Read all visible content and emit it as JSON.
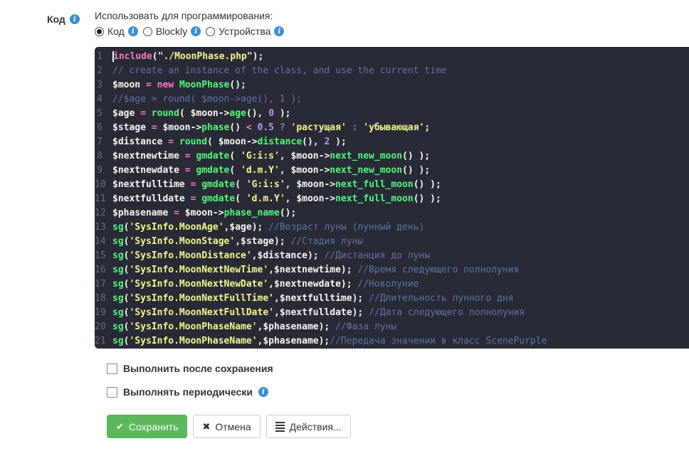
{
  "colors": {
    "info-icon": "#3d8fd1",
    "editor-bg": "#282a36",
    "code-text": "#f8f8f2",
    "tok-kw": "#ff79c6",
    "tok-fn": "#50fa7b",
    "tok-str": "#f1fa8c",
    "tok-num": "#bd93f9",
    "tok-cm": "#6272a4",
    "line-number": "#636d83",
    "save-bg": "#5cb85c",
    "save-border": "#4cae4c",
    "btn-border": "#cccccc"
  },
  "icons": {
    "save": "✔",
    "cancel": "✖"
  },
  "form": {
    "field_label": "Код",
    "usage_label": "Использовать для программирования:",
    "options": [
      {
        "key": "code",
        "label": "Код",
        "selected": true,
        "info": true
      },
      {
        "key": "blockly",
        "label": "Blockly",
        "selected": false,
        "info": true
      },
      {
        "key": "devices",
        "label": "Устройства",
        "selected": false,
        "info": true
      }
    ],
    "checkboxes": [
      {
        "key": "run-after-save",
        "label": "Выполнить после сохранения",
        "checked": false,
        "info": false
      },
      {
        "key": "run-periodically",
        "label": "Выполнять периодически",
        "checked": false,
        "info": true
      }
    ],
    "buttons": {
      "save": "Сохранить",
      "cancel": "Отмена",
      "actions": "Действия..."
    }
  },
  "editor": {
    "language": "php",
    "cursor": {
      "line": 1,
      "col": 0
    },
    "lines": [
      [
        [
          "kw",
          "include"
        ],
        [
          "pl",
          "("
        ],
        [
          "str",
          "\"./MoonPhase.php\""
        ],
        [
          "pl",
          ");"
        ]
      ],
      [
        [
          "cm",
          "// create an instance of the class, and use the current time"
        ]
      ],
      [
        [
          "var",
          "$moon"
        ],
        [
          "pl",
          " "
        ],
        [
          "kw",
          "="
        ],
        [
          "pl",
          " "
        ],
        [
          "kw",
          "new"
        ],
        [
          "pl",
          " "
        ],
        [
          "fn",
          "MoonPhase"
        ],
        [
          "pl",
          "();"
        ]
      ],
      [
        [
          "cm",
          "//$age = round( $moon->age(), 1 );"
        ]
      ],
      [
        [
          "var",
          "$age"
        ],
        [
          "pl",
          " "
        ],
        [
          "kw",
          "="
        ],
        [
          "pl",
          " "
        ],
        [
          "fn",
          "round"
        ],
        [
          "pl",
          "( "
        ],
        [
          "var",
          "$moon"
        ],
        [
          "pl",
          "->"
        ],
        [
          "fn",
          "age"
        ],
        [
          "pl",
          "(), "
        ],
        [
          "num",
          "0"
        ],
        [
          "pl",
          " );"
        ]
      ],
      [
        [
          "var",
          "$stage"
        ],
        [
          "pl",
          " "
        ],
        [
          "kw",
          "="
        ],
        [
          "pl",
          " "
        ],
        [
          "var",
          "$moon"
        ],
        [
          "pl",
          "->"
        ],
        [
          "fn",
          "phase"
        ],
        [
          "pl",
          "() "
        ],
        [
          "kw",
          "<"
        ],
        [
          "pl",
          " "
        ],
        [
          "num",
          "0.5"
        ],
        [
          "dim",
          " ? "
        ],
        [
          "str",
          "'растущая'"
        ],
        [
          "dim",
          " : "
        ],
        [
          "str",
          "'убывающая'"
        ],
        [
          "pl",
          ";"
        ]
      ],
      [
        [
          "var",
          "$distance"
        ],
        [
          "pl",
          " "
        ],
        [
          "kw",
          "="
        ],
        [
          "pl",
          " "
        ],
        [
          "fn",
          "round"
        ],
        [
          "pl",
          "( "
        ],
        [
          "var",
          "$moon"
        ],
        [
          "pl",
          "->"
        ],
        [
          "fn",
          "distance"
        ],
        [
          "pl",
          "(), "
        ],
        [
          "num",
          "2"
        ],
        [
          "pl",
          " );"
        ]
      ],
      [
        [
          "var",
          "$nextnewtime"
        ],
        [
          "pl",
          " "
        ],
        [
          "kw",
          "="
        ],
        [
          "pl",
          " "
        ],
        [
          "fn",
          "gmdate"
        ],
        [
          "pl",
          "( "
        ],
        [
          "str",
          "'G:i:s'"
        ],
        [
          "pl",
          ", "
        ],
        [
          "var",
          "$moon"
        ],
        [
          "pl",
          "->"
        ],
        [
          "fn",
          "next_new_moon"
        ],
        [
          "pl",
          "() );"
        ]
      ],
      [
        [
          "var",
          "$nextnewdate"
        ],
        [
          "pl",
          " "
        ],
        [
          "kw",
          "="
        ],
        [
          "pl",
          " "
        ],
        [
          "fn",
          "gmdate"
        ],
        [
          "pl",
          "( "
        ],
        [
          "str",
          "'d.m.Y'"
        ],
        [
          "pl",
          ", "
        ],
        [
          "var",
          "$moon"
        ],
        [
          "pl",
          "->"
        ],
        [
          "fn",
          "next_new_moon"
        ],
        [
          "pl",
          "() );"
        ]
      ],
      [
        [
          "var",
          "$nextfulltime"
        ],
        [
          "pl",
          " "
        ],
        [
          "kw",
          "="
        ],
        [
          "pl",
          " "
        ],
        [
          "fn",
          "gmdate"
        ],
        [
          "pl",
          "( "
        ],
        [
          "str",
          "'G:i:s'"
        ],
        [
          "pl",
          ", "
        ],
        [
          "var",
          "$moon"
        ],
        [
          "pl",
          "->"
        ],
        [
          "fn",
          "next_full_moon"
        ],
        [
          "pl",
          "() );"
        ]
      ],
      [
        [
          "var",
          "$nextfulldate"
        ],
        [
          "pl",
          " "
        ],
        [
          "kw",
          "="
        ],
        [
          "pl",
          " "
        ],
        [
          "fn",
          "gmdate"
        ],
        [
          "pl",
          "( "
        ],
        [
          "str",
          "'d.m.Y'"
        ],
        [
          "pl",
          ", "
        ],
        [
          "var",
          "$moon"
        ],
        [
          "pl",
          "->"
        ],
        [
          "fn",
          "next_full_moon"
        ],
        [
          "pl",
          "() );"
        ]
      ],
      [
        [
          "var",
          "$phasename"
        ],
        [
          "pl",
          " "
        ],
        [
          "kw",
          "="
        ],
        [
          "pl",
          " "
        ],
        [
          "var",
          "$moon"
        ],
        [
          "pl",
          "->"
        ],
        [
          "fn",
          "phase_name"
        ],
        [
          "pl",
          "();"
        ]
      ],
      [
        [
          "fn",
          "sg"
        ],
        [
          "pl",
          "("
        ],
        [
          "str",
          "'SysInfo.MoonAge'"
        ],
        [
          "pl",
          ","
        ],
        [
          "var",
          "$age"
        ],
        [
          "pl",
          "); "
        ],
        [
          "cm",
          "//Возраст луны (лунный день)"
        ]
      ],
      [
        [
          "fn",
          "sg"
        ],
        [
          "pl",
          "("
        ],
        [
          "str",
          "'SysInfo.MoonStage'"
        ],
        [
          "pl",
          ","
        ],
        [
          "var",
          "$stage"
        ],
        [
          "pl",
          "); "
        ],
        [
          "cm",
          "//Стадия луны"
        ]
      ],
      [
        [
          "fn",
          "sg"
        ],
        [
          "pl",
          "("
        ],
        [
          "str",
          "'SysInfo.MoonDistance'"
        ],
        [
          "pl",
          ","
        ],
        [
          "var",
          "$distance"
        ],
        [
          "pl",
          "); "
        ],
        [
          "cm",
          "//Дистанция до луны"
        ]
      ],
      [
        [
          "fn",
          "sg"
        ],
        [
          "pl",
          "("
        ],
        [
          "str",
          "'SysInfo.MoonNextNewTime'"
        ],
        [
          "pl",
          ","
        ],
        [
          "var",
          "$nextnewtime"
        ],
        [
          "pl",
          "); "
        ],
        [
          "cm",
          "//Время следующего полнолуния"
        ]
      ],
      [
        [
          "fn",
          "sg"
        ],
        [
          "pl",
          "("
        ],
        [
          "str",
          "'SysInfo.MoonNextNewDate'"
        ],
        [
          "pl",
          ","
        ],
        [
          "var",
          "$nextnewdate"
        ],
        [
          "pl",
          "); "
        ],
        [
          "cm",
          "//Новолуние"
        ]
      ],
      [
        [
          "fn",
          "sg"
        ],
        [
          "pl",
          "("
        ],
        [
          "str",
          "'SysInfo.MoonNextFullTime'"
        ],
        [
          "pl",
          ","
        ],
        [
          "var",
          "$nextfulltime"
        ],
        [
          "pl",
          "); "
        ],
        [
          "cm",
          "//Длительность лунного дня"
        ]
      ],
      [
        [
          "fn",
          "sg"
        ],
        [
          "pl",
          "("
        ],
        [
          "str",
          "'SysInfo.MoonNextFullDate'"
        ],
        [
          "pl",
          ","
        ],
        [
          "var",
          "$nextfulldate"
        ],
        [
          "pl",
          "); "
        ],
        [
          "cm",
          "//Дата следующего полнолуния"
        ]
      ],
      [
        [
          "fn",
          "sg"
        ],
        [
          "pl",
          "("
        ],
        [
          "str",
          "'SysInfo.MoonPhaseName'"
        ],
        [
          "pl",
          ","
        ],
        [
          "var",
          "$phasename"
        ],
        [
          "pl",
          "); "
        ],
        [
          "cm",
          "//Фаза луны"
        ]
      ],
      [
        [
          "fn",
          "sg"
        ],
        [
          "pl",
          "("
        ],
        [
          "str",
          "'SysInfo.MoonPhaseName'"
        ],
        [
          "pl",
          ","
        ],
        [
          "var",
          "$phasename"
        ],
        [
          "pl",
          ");"
        ],
        [
          "cm",
          "//Передача значении в класс ScenePurple"
        ]
      ]
    ]
  }
}
